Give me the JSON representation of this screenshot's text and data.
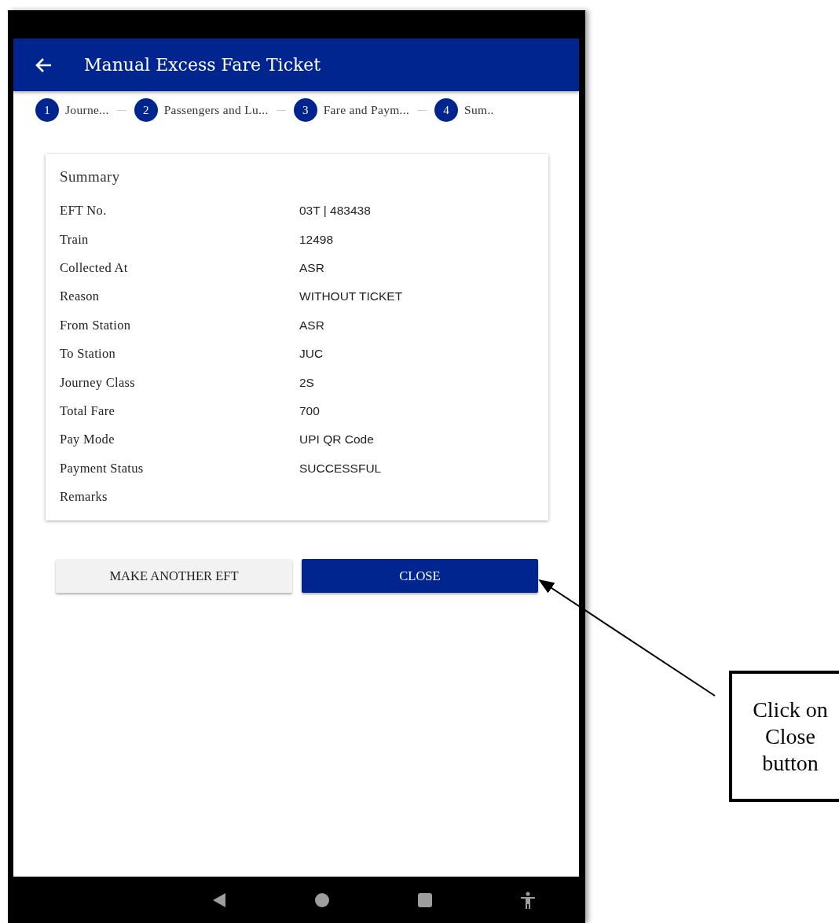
{
  "app_bar": {
    "title": "Manual Excess Fare Ticket"
  },
  "steps": [
    {
      "number": "1",
      "label": "Journe..."
    },
    {
      "number": "2",
      "label": "Passengers and Lu..."
    },
    {
      "number": "3",
      "label": "Fare and Paym..."
    },
    {
      "number": "4",
      "label": "Sum.."
    }
  ],
  "summary": {
    "title": "Summary",
    "rows": [
      {
        "label": "EFT No.",
        "value": "03T | 483438"
      },
      {
        "label": "Train",
        "value": "12498"
      },
      {
        "label": "Collected At",
        "value": "ASR"
      },
      {
        "label": "Reason",
        "value": "WITHOUT TICKET"
      },
      {
        "label": "From Station",
        "value": "ASR"
      },
      {
        "label": "To Station",
        "value": "JUC"
      },
      {
        "label": "Journey Class",
        "value": "2S"
      },
      {
        "label": "Total Fare",
        "value": "700"
      },
      {
        "label": "Pay Mode",
        "value": "UPI QR Code"
      },
      {
        "label": "Payment Status",
        "value": "SUCCESSFUL"
      },
      {
        "label": "Remarks"
      }
    ]
  },
  "buttons": [
    {
      "label": "MAKE ANOTHER EFT",
      "kind": "secondary"
    },
    {
      "label": "CLOSE",
      "kind": "primary"
    }
  ],
  "callout": {
    "text": "Click on Close button"
  }
}
